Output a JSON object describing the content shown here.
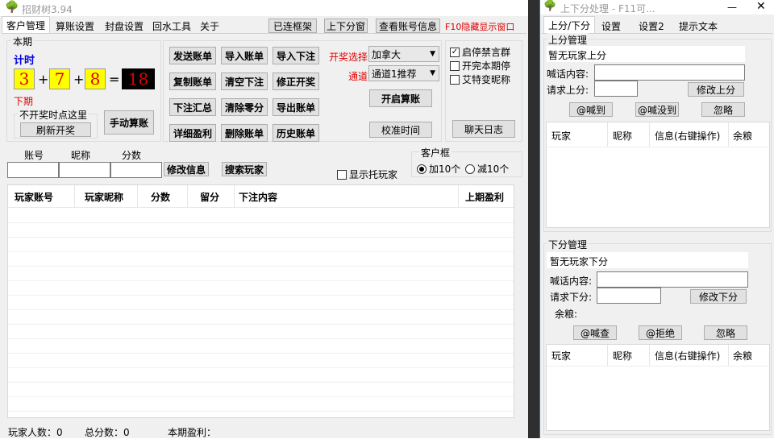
{
  "main_window": {
    "title": "招财树3.94",
    "tabs": [
      "客户管理",
      "算账设置",
      "封盘设置",
      "回水工具",
      "关于"
    ],
    "top_buttons": [
      "已连框架",
      "上下分窗",
      "查看账号信息"
    ],
    "hide_hint": "F10隐藏显示窗口",
    "current_period": {
      "group_label": "本期",
      "timer_label": "计时",
      "digits": [
        "3",
        "7",
        "8"
      ],
      "plus1": "+",
      "plus2": "+",
      "equals": "=",
      "result": "18",
      "next_label": "下期",
      "no_draw_group": "不开奖时点这里",
      "refresh_button": "刷新开奖",
      "manual_button": "手动算账"
    },
    "action_buttons": [
      [
        "发送账单",
        "导入账单",
        "导入下注"
      ],
      [
        "复制账单",
        "清空下注",
        "修正开奖"
      ],
      [
        "下注汇总",
        "清除零分",
        "导出账单"
      ],
      [
        "详细盈利",
        "删除账单",
        "历史账单"
      ]
    ],
    "draw_select_label": "开奖选择",
    "draw_select_value": "加拿大",
    "channel_label": "通道",
    "channel_value": "通道1推荐",
    "start_button": "开启算账",
    "calibrate_button": "校准时间",
    "checkboxes": [
      {
        "label": "启停禁言群",
        "checked": true
      },
      {
        "label": "开完本期停",
        "checked": false
      },
      {
        "label": "艾特变昵称",
        "checked": false
      }
    ],
    "chat_log_button": "聊天日志",
    "search": {
      "col_account": "账号",
      "col_nick": "昵称",
      "col_score": "分数",
      "modify_button": "修改信息",
      "search_button": "搜索玩家",
      "show_bots": "显示托玩家"
    },
    "client_box": {
      "title": "客户框",
      "plus10": "加10个",
      "minus10": "减10个"
    },
    "table_headers": [
      "玩家账号",
      "玩家昵称",
      "分数",
      "留分",
      "下注内容",
      "上期盈利"
    ],
    "status": {
      "players": "玩家人数：0",
      "total_score": "总分数：0",
      "period_profit": "本期盈利："
    }
  },
  "side_window": {
    "title": "上下分处理 - F11可...",
    "tabs": [
      "上分/下分",
      "设置",
      "设置2",
      "提示文本"
    ],
    "up": {
      "group_label": "上分管理",
      "status_text": "暂无玩家上分",
      "shout_label": "喊话内容:",
      "request_label": "请求上分:",
      "modify_button": "修改上分",
      "buttons": [
        "@喊到",
        "@喊没到",
        "忽略"
      ],
      "table_headers": [
        "玩家",
        "昵称",
        "信息(右键操作)",
        "余粮"
      ]
    },
    "down": {
      "group_label": "下分管理",
      "status_text": "暂无玩家下分",
      "shout_label": "喊话内容:",
      "request_label": "请求下分:",
      "modify_button": "修改下分",
      "balance_label": "余粮:",
      "buttons": [
        "@喊查",
        "@拒绝",
        "忽略"
      ],
      "table_headers": [
        "玩家",
        "昵称",
        "信息(右键操作)",
        "余粮"
      ]
    }
  },
  "colors": {
    "red": "#e00000",
    "blue": "#0000e0",
    "yellow": "#ffff00",
    "window_bg": "#f0f0f0"
  },
  "icons": [
    "tree-icon",
    "minimize-icon",
    "close-icon"
  ]
}
